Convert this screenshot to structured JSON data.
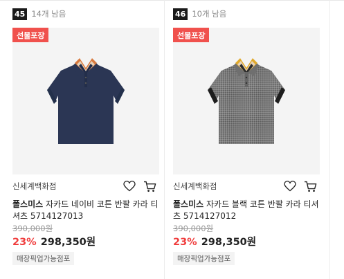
{
  "products": [
    {
      "rank": "45",
      "stock": "14개 남음",
      "badge": "선물포장",
      "seller": "신세계백화점",
      "brand": "폴스미스",
      "name": " 자카드 네이비 코튼 반팔 카라 티셔츠 5714127013",
      "original_price": "390,000원",
      "discount": "23%",
      "price": "298,350원",
      "tag": "매장픽업가능점포",
      "icons": {
        "wishlist": "heart-outline-icon",
        "cart": "cart-icon"
      },
      "colors": {
        "shirt": "#2b3654",
        "collar_stripe": [
          "#d87a3f",
          "#e8d2b8",
          "#1f2a48"
        ]
      }
    },
    {
      "rank": "46",
      "stock": "10개 남음",
      "badge": "선물포장",
      "seller": "신세계백화점",
      "brand": "폴스미스",
      "name": " 자카드 블랙 코튼 반팔 카라 티셔츠 5714127012",
      "original_price": "390,000원",
      "discount": "23%",
      "price": "298,350원",
      "tag": "매장픽업가능점포",
      "icons": {
        "wishlist": "heart-outline-icon",
        "cart": "cart-icon"
      },
      "colors": {
        "shirt": "#7a7a7a",
        "collar_stripe": [
          "#e0a92b",
          "#e8d2b8",
          "#2b2b2b"
        ]
      }
    }
  ],
  "theme": {
    "accent_red": "#f03e3e",
    "badge_red": "#f0514d",
    "rank_bg": "#1a1a1a"
  }
}
